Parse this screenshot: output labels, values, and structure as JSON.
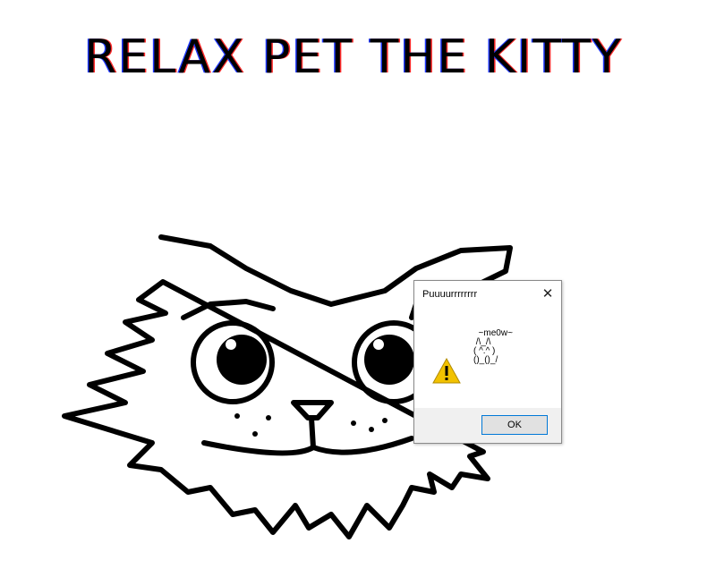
{
  "page": {
    "heading": "RELAX PET THE KITTY"
  },
  "dialog": {
    "title": "Puuuurrrrrrrr",
    "close_symbol": "✕",
    "message": "  ~me0w~\n /\\_/\\\n( ^.^ )\n()_()_/",
    "icon": "warning-icon",
    "ok_label": "OK"
  },
  "colors": {
    "accent": "#0078d7",
    "warning": "#f2c200"
  }
}
